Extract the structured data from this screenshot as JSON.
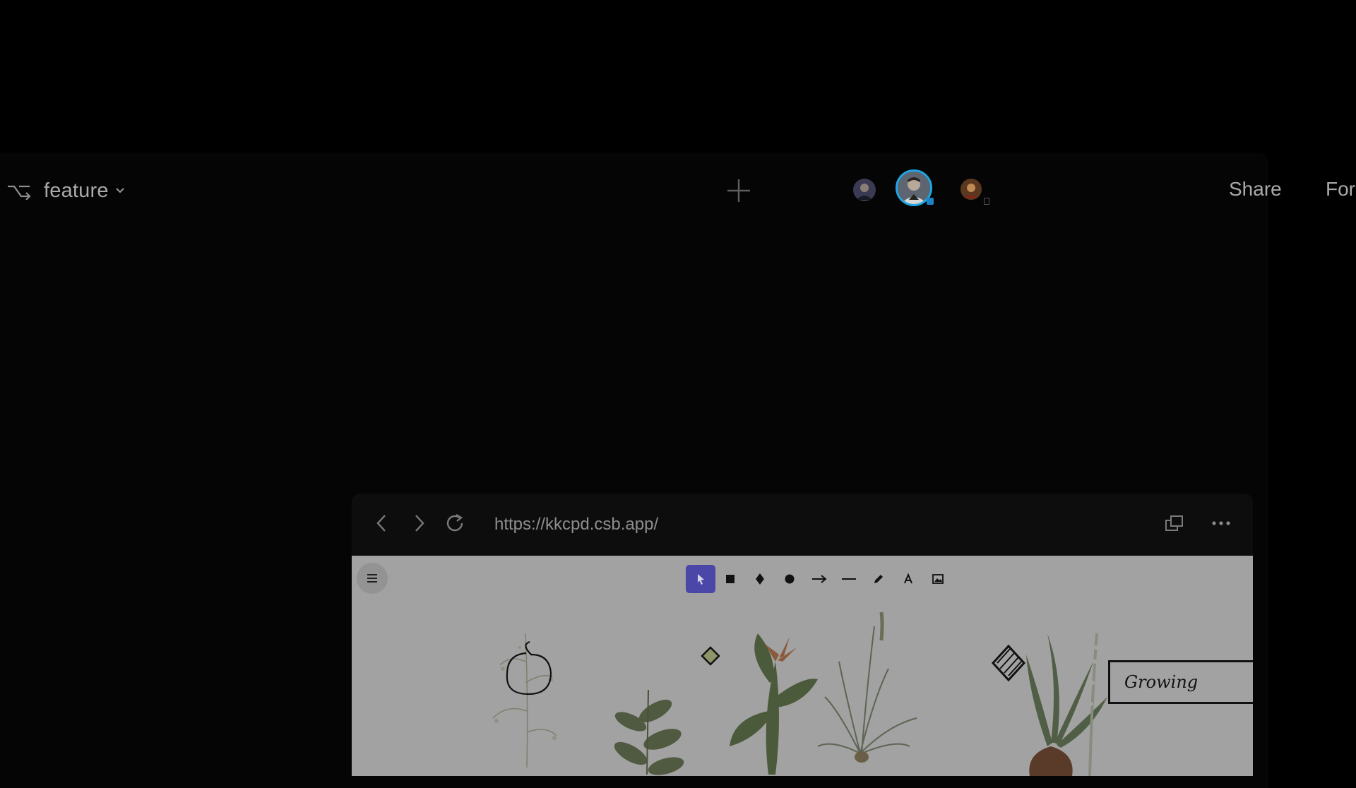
{
  "topbar": {
    "branch_icon": "branch-icon",
    "branch_label": "feature",
    "branch_dropdown_icon": "chevron-down-icon",
    "add_icon": "plus-icon",
    "avatars": [
      {
        "name": "avatar-user-1"
      },
      {
        "name": "avatar-user-2-active"
      },
      {
        "name": "avatar-user-3"
      }
    ],
    "share_label": "Share",
    "fork_label": "For"
  },
  "preview": {
    "back_icon": "chevron-left-icon",
    "forward_icon": "chevron-right-icon",
    "refresh_icon": "refresh-icon",
    "url": "https://kkcpd.csb.app/",
    "open_window_icon": "open-in-new-window-icon",
    "more_icon": "more-horizontal-icon",
    "canvas": {
      "menu_icon": "hamburger-menu-icon",
      "tools": [
        {
          "name": "select-tool",
          "icon": "cursor-icon",
          "active": true
        },
        {
          "name": "rectangle-tool",
          "icon": "square-icon"
        },
        {
          "name": "diamond-tool",
          "icon": "diamond-icon"
        },
        {
          "name": "ellipse-tool",
          "icon": "circle-icon"
        },
        {
          "name": "arrow-tool",
          "icon": "arrow-right-icon"
        },
        {
          "name": "line-tool",
          "icon": "line-icon"
        },
        {
          "name": "draw-tool",
          "icon": "pencil-icon"
        },
        {
          "name": "text-tool",
          "icon": "text-icon"
        },
        {
          "name": "image-tool",
          "icon": "image-icon"
        }
      ],
      "text_box_label": "Growing",
      "accent_color": "#4a47a8"
    }
  }
}
